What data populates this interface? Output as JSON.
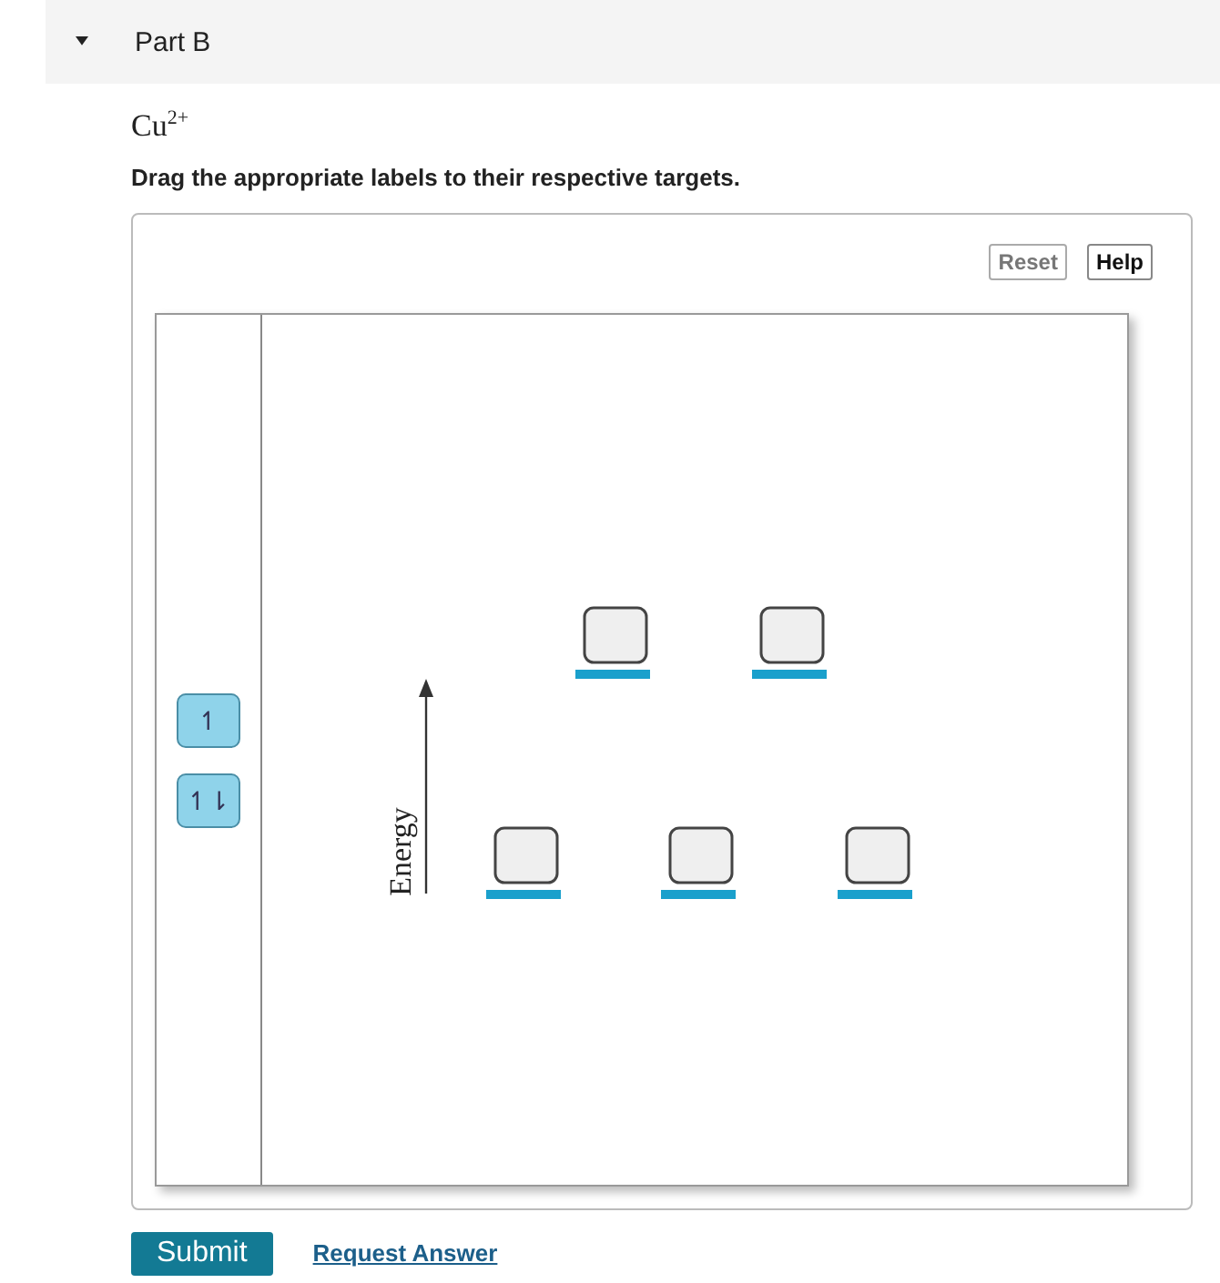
{
  "part": {
    "title": "Part B",
    "expanded": true
  },
  "formula": "Cu$^{2+}$",
  "instruction": "Drag the appropriate labels to their respective targets.",
  "toolbar": [
    {
      "label": "Reset",
      "disabled": true
    },
    {
      "label": "Help",
      "disabled": false
    }
  ],
  "labels": [
    "↿",
    "↿⇂"
  ],
  "axis_label": "Energy",
  "actions": {
    "submit": "Submit",
    "request": "Request Answer"
  }
}
